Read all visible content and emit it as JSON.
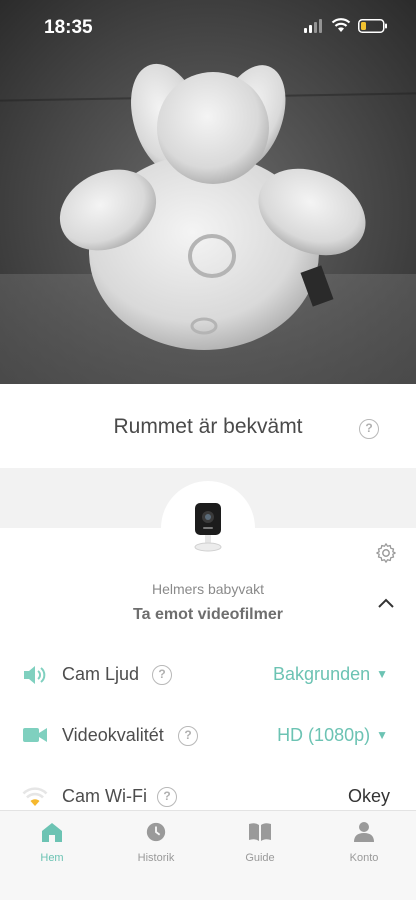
{
  "status_bar": {
    "time": "18:35"
  },
  "comfort": {
    "title": "Rummet är bekvämt",
    "help_icon": "question-circle-icon"
  },
  "device": {
    "name": "Helmers babyvakt",
    "action": "Ta emot videofilmer",
    "settings_icon": "gear-icon",
    "collapse_icon": "chevron-up-icon"
  },
  "settings": [
    {
      "label": "Cam Ljud",
      "value": "Bakgrunden",
      "icon": "speaker-icon",
      "dropdown": true
    },
    {
      "label": "Videokvalitét",
      "value": "HD (1080p)",
      "icon": "video-camera-icon",
      "dropdown": true
    },
    {
      "label": "Cam Wi-Fi",
      "value": "Okey",
      "icon": "wifi-icon",
      "dropdown": false
    }
  ],
  "tabs": [
    {
      "label": "Hem",
      "icon": "home-icon",
      "active": true
    },
    {
      "label": "Historik",
      "icon": "clock-icon",
      "active": false
    },
    {
      "label": "Guide",
      "icon": "book-icon",
      "active": false
    },
    {
      "label": "Konto",
      "icon": "person-icon",
      "active": false
    }
  ],
  "colors": {
    "accent": "#6cc3b3",
    "text": "#4d4d4d",
    "muted": "#999999"
  }
}
